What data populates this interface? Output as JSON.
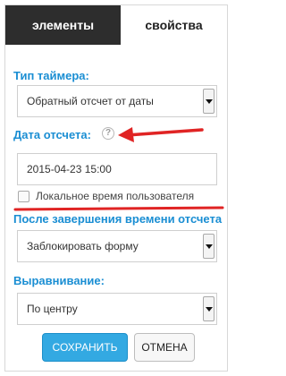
{
  "tabs": {
    "elements": "элементы",
    "properties": "свойства",
    "active": "elements"
  },
  "timer_type": {
    "label": "Тип таймера:",
    "value": "Обратный отсчет от даты"
  },
  "countdown_date": {
    "label": "Дата отсчета:",
    "help_icon": "?",
    "value": "2015-04-23 15:00"
  },
  "local_time": {
    "label": "Локальное время пользователя",
    "checked": false
  },
  "after_finish": {
    "label": "После завершения времени отсчета",
    "value": "Заблокировать форму"
  },
  "alignment": {
    "label": "Выравнивание:",
    "value": "По центру"
  },
  "buttons": {
    "save": "СОХРАНИТЬ",
    "cancel": "ОТМЕНА"
  },
  "colors": {
    "accent": "#1a8ed3",
    "annotation": "#e02424",
    "tab_active_bg": "#2d2d2d",
    "save_button": "#33a9e2"
  }
}
